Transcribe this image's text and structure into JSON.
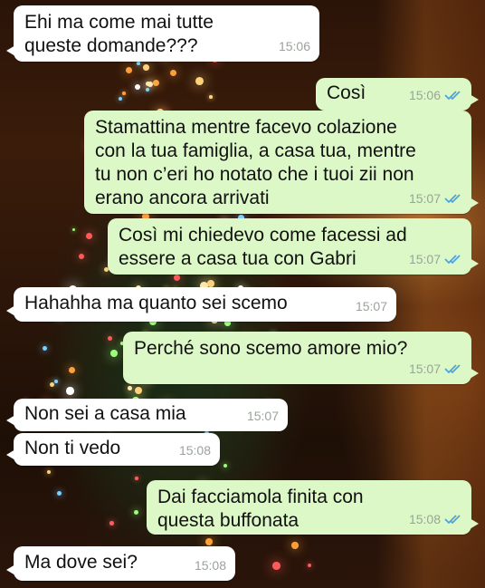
{
  "colors": {
    "incoming_bubble": "#ffffff",
    "outgoing_bubble": "#dcf8c6",
    "timestamp": "#9aa39a",
    "read_check": "#4fa3e0"
  },
  "messages": [
    {
      "dir": "in",
      "text": "Ehi ma come mai tutte\nqueste domande???",
      "time": "15:06",
      "read": false
    },
    {
      "dir": "out",
      "text": "Così",
      "time": "15:06",
      "read": true
    },
    {
      "dir": "out",
      "text": "Stamattina mentre facevo colazione\ncon la tua famiglia, a casa tua, mentre\ntu non c’eri ho notato che i tuoi zii non\nerano ancora arrivati",
      "time": "15:07",
      "read": true
    },
    {
      "dir": "out",
      "text": "Così mi chiedevo come facessi ad\nessere a casa tua con Gabri",
      "time": "15:07",
      "read": true
    },
    {
      "dir": "in",
      "text": "Hahahha ma quanto sei scemo",
      "time": "15:07",
      "read": false
    },
    {
      "dir": "out",
      "text": "Perché sono scemo amore mio?",
      "time": "15:07",
      "read": true
    },
    {
      "dir": "in",
      "text": "Non sei a casa mia",
      "time": "15:07",
      "read": false
    },
    {
      "dir": "in",
      "text": "Non ti vedo",
      "time": "15:08",
      "read": false
    },
    {
      "dir": "out",
      "text": "Dai facciamola finita con\nquesta buffonata",
      "time": "15:08",
      "read": true
    },
    {
      "dir": "in",
      "text": "Ma dove sei?",
      "time": "15:08",
      "read": false
    }
  ]
}
